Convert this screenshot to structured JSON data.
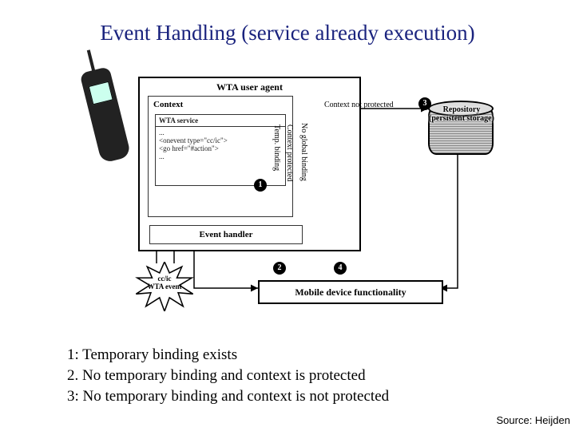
{
  "title": "Event Handling (service already execution)",
  "diagram": {
    "ua_label": "WTA user agent",
    "context_label": "Context",
    "service_header": "WTA service",
    "service_body_line1": "...",
    "service_body_line2": "<onevent type=\"cc/ic\">",
    "service_body_line3": "  <go href=\"#action\">",
    "service_body_line4": "...",
    "handler_label": "Event handler",
    "path_labels": {
      "temp_binding": "Temp. binding",
      "context_protected": "Context protected",
      "no_global_binding": "No global binding"
    },
    "top_arrow_label": "Context not protected",
    "repository_label": "Repository (persistent storage)",
    "mdf_label": "Mobile device functionality",
    "starburst_line1": "cc/ic",
    "starburst_line2": "WTA event",
    "markers": {
      "m1": "1",
      "m2": "2",
      "m3": "3",
      "m4": "4"
    }
  },
  "legend": {
    "l1": "1: Temporary binding exists",
    "l2": "2. No temporary binding and context is protected",
    "l3": "3: No temporary binding and context is not protected"
  },
  "source": "Source: Heijden"
}
